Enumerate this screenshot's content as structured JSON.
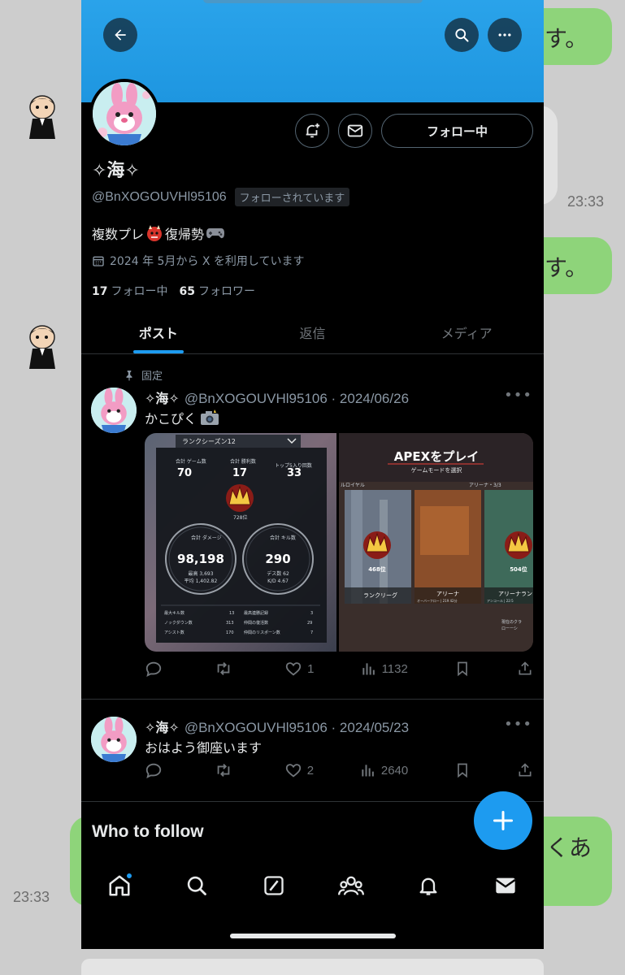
{
  "chat": {
    "bubble_texts": [
      "す。",
      "す。",
      "くあ"
    ],
    "times": [
      "23:33",
      "23:33"
    ]
  },
  "profile": {
    "display_name": "✧海✧",
    "handle": "@BnXOGOUVHl95106",
    "follows_you_badge": "フォローされています",
    "follow_button_label": "フォロー中",
    "bio_part1": "複数プレ",
    "bio_part2": "復帰勢",
    "joined": "2024 年 5月から X を利用しています",
    "following_count": "17",
    "following_label": "フォロー中",
    "followers_count": "65",
    "followers_label": "フォロワー"
  },
  "tabs": [
    {
      "label": "ポスト",
      "active": true
    },
    {
      "label": "返信",
      "active": false
    },
    {
      "label": "メディア",
      "active": false
    }
  ],
  "posts": [
    {
      "pinned_label": "固定",
      "name": "✧海✧",
      "meta": "@BnXOGOUVHl95106 · 2024/06/26",
      "text": "かこぴく",
      "replies": "",
      "reposts": "",
      "likes": "1",
      "views": "1132",
      "media": {
        "left": {
          "header": "ランクシーズン12",
          "stats_top": [
            {
              "label": "合計 ゲーム数",
              "value": "70"
            },
            {
              "label": "合計 勝利数",
              "value": "17"
            },
            {
              "label": "トップ5入り回数",
              "value": "33"
            }
          ],
          "rank": "728位",
          "damage_label": "合計 ダメージ",
          "damage_value": "98,198",
          "damage_sub1": "最高 3,693",
          "damage_sub2": "平均 1,402.82",
          "kills_label": "合計 キル数",
          "kills_value": "290",
          "kills_sub1": "デス数 62",
          "kills_sub2": "K/D 4.67",
          "rows": [
            [
              "最大キル数",
              "13",
              "最高連勝記録",
              "3"
            ],
            [
              "ノックダウン数",
              "313",
              "仲間の復活数",
              "29"
            ],
            [
              "アシスト数",
              "170",
              "仲間のリスポーン数",
              "7"
            ]
          ]
        },
        "right": {
          "title": "APEXをプレイ",
          "subtitle": "ゲームモードを選択",
          "section_left": "ルロイヤル",
          "section_right": "アリーナ・3/3",
          "cards": [
            {
              "rank": "468位",
              "label": "ランクリーグ"
            },
            {
              "rank": "",
              "label": "アリーナ"
            },
            {
              "rank": "504位",
              "label": "アリーナラン"
            }
          ],
          "card2_sub": "オーバーフロー | 219 42分",
          "card3_sub": "アンコール | 22:5",
          "footer1": "現在のクラ",
          "footer2": "ローーシ"
        }
      }
    },
    {
      "pinned_label": "",
      "name": "✧海✧",
      "meta": "@BnXOGOUVHl95106 · 2024/05/23",
      "text": "おはよう御座います",
      "replies": "",
      "reposts": "",
      "likes": "2",
      "views": "2640"
    }
  ],
  "who_to_follow": "Who to follow",
  "colors": {
    "accent": "#1d9bf0",
    "banner": "#2aa3ea",
    "chat_green": "#8ed47a"
  }
}
